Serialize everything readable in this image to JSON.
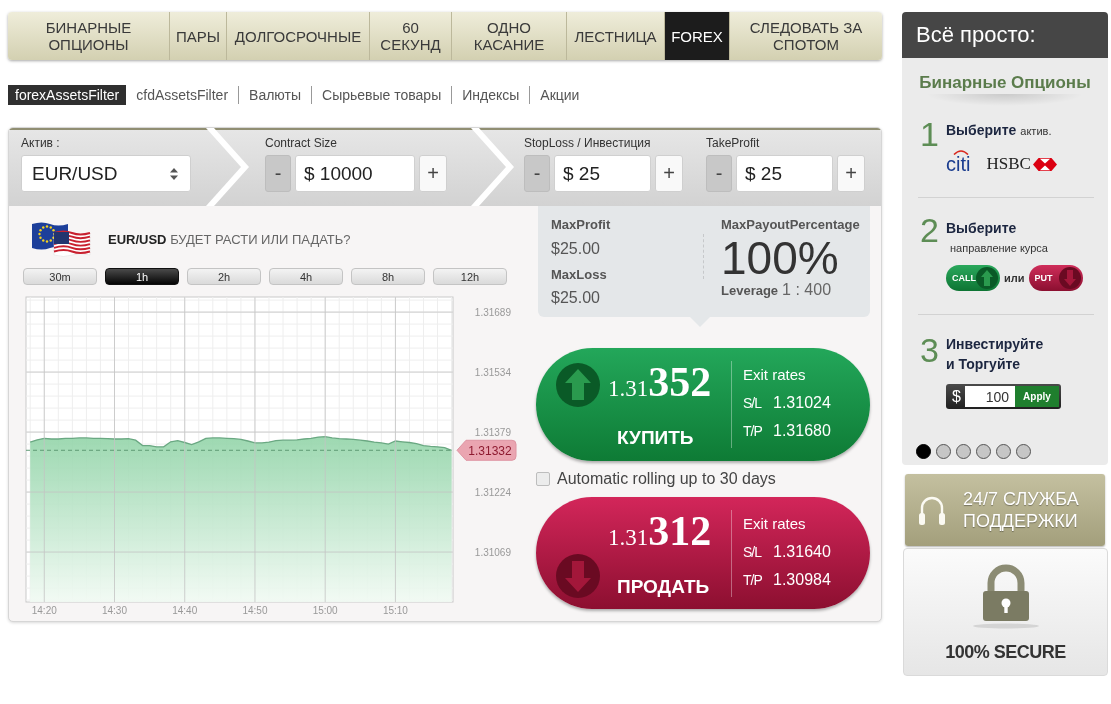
{
  "nav_tabs": [
    {
      "label": "БИНАРНЫЕ ОПЦИОНЫ",
      "selected": false
    },
    {
      "label": "ПАРЫ",
      "selected": false
    },
    {
      "label": "ДОЛГОСРОЧНЫЕ",
      "selected": false
    },
    {
      "label": "60 СЕКУНД",
      "selected": false
    },
    {
      "label": "ОДНО КАСАНИЕ",
      "selected": false
    },
    {
      "label": "ЛЕСТНИЦА",
      "selected": false
    },
    {
      "label": "FOREX",
      "selected": true
    },
    {
      "label": "СЛЕДОВАТЬ ЗА СПОТОМ",
      "selected": false
    }
  ],
  "asset_filters": [
    {
      "label": "forexAssetsFilter",
      "selected": true
    },
    {
      "label": "cfdAssetsFilter",
      "selected": false
    },
    {
      "label": "Валюты",
      "selected": false
    },
    {
      "label": "Сырьевые товары",
      "selected": false
    },
    {
      "label": "Индексы",
      "selected": false
    },
    {
      "label": "Акции",
      "selected": false
    }
  ],
  "order_bar": {
    "asset": {
      "label": "Актив :",
      "value": "EUR/USD"
    },
    "contract_size": {
      "label": "Contract Size",
      "decrement": "-",
      "value": "$ 10000",
      "increment": "+"
    },
    "stop_loss": {
      "label": "StopLoss / Инвестиция",
      "decrement": "-",
      "value": "$ 25",
      "increment": "+"
    },
    "take_profit": {
      "label": "TakeProfit",
      "decrement": "-",
      "value": "$ 25",
      "increment": "+"
    }
  },
  "chart_panel": {
    "title": "**EUR/USD** БУДЕТ РАСТИ ИЛИ ПАДАТЬ?",
    "timeframes": [
      {
        "label": "30m",
        "selected": false
      },
      {
        "label": "1h",
        "selected": true
      },
      {
        "label": "2h",
        "selected": false
      },
      {
        "label": "4h",
        "selected": false
      },
      {
        "label": "8h",
        "selected": false
      },
      {
        "label": "12h",
        "selected": false
      }
    ],
    "chart_data": {
      "type": "area",
      "categories": [
        null,
        null,
        "14:20",
        null,
        null,
        null,
        null,
        null,
        null,
        null,
        null,
        null,
        "14:30",
        null,
        null,
        null,
        null,
        null,
        null,
        null,
        null,
        null,
        "14:40",
        null,
        null,
        null,
        null,
        null,
        null,
        null,
        null,
        null,
        "14:50",
        null,
        null,
        null,
        null,
        null,
        null,
        null,
        null,
        null,
        "15:00",
        null,
        null,
        null,
        null,
        null,
        null,
        null,
        null,
        null,
        "15:10",
        null,
        null,
        null,
        null,
        null,
        null,
        null,
        null
      ],
      "values": [
        1.31353,
        1.31359,
        1.31363,
        1.31361,
        1.31361,
        1.31363,
        1.31363,
        1.31364,
        1.31364,
        1.31363,
        1.31363,
        1.31362,
        1.31361,
        1.31361,
        1.31362,
        1.31358,
        1.31344,
        1.31344,
        1.31341,
        1.31341,
        1.31354,
        1.31357,
        1.31352,
        1.31347,
        1.31354,
        1.31363,
        1.31364,
        1.31364,
        1.31363,
        1.31362,
        1.3136,
        1.31356,
        1.31351,
        1.31351,
        1.31353,
        1.31357,
        1.31358,
        1.31358,
        1.31359,
        1.31361,
        1.31363,
        1.31366,
        1.31367,
        1.31364,
        1.31362,
        1.31361,
        1.3136,
        1.31358,
        1.31356,
        1.31353,
        1.31351,
        1.31348,
        1.31356,
        1.31354,
        1.31352,
        1.31349,
        1.31344,
        1.31342,
        1.31341,
        1.31339,
        1.31332
      ],
      "ylim": [
        1.3094,
        1.31728
      ],
      "yticks": [
        1.31689,
        1.31534,
        1.31379,
        1.31224,
        1.31069
      ],
      "grid": true,
      "ref_lines": [
        {
          "axis": "y",
          "value": 1.31332,
          "label": "1.31332"
        }
      ]
    }
  },
  "summary": {
    "max_profit": {
      "label": "MaxProfit",
      "value": "$25.00"
    },
    "max_loss": {
      "label": "MaxLoss",
      "value": "$25.00"
    },
    "max_payout": {
      "label": "MaxPayoutPercentage",
      "value": "100%"
    },
    "leverage": {
      "label": "Leverage",
      "value": "1 : 400"
    }
  },
  "buy_button": {
    "kind": "buy",
    "price": "1.31**352**",
    "action": "КУПИТЬ",
    "exit_title": "Exit rates",
    "exit_rates": [
      {
        "label": "S/L",
        "value": "1.31024"
      },
      {
        "label": "T/P",
        "value": "1.31680"
      }
    ]
  },
  "auto_rolling": {
    "label": "Automatic rolling up to 30 days",
    "checked": false
  },
  "sell_button": {
    "kind": "sell",
    "price": "1.31**312**",
    "action": "ПРОДАТЬ",
    "exit_title": "Exit rates",
    "exit_rates": [
      {
        "label": "S/L",
        "value": "1.31640"
      },
      {
        "label": "T/P",
        "value": "1.30984"
      }
    ]
  },
  "sidebar": {
    "header": "Всё просто:",
    "subtitle": "Бинарные Опционы",
    "steps": [
      {
        "number": "1",
        "kind": "logos",
        "title": "Выберите",
        "note": "актив.",
        "logos": [
          "citi",
          "HSBC"
        ]
      },
      {
        "number": "2",
        "kind": "direction",
        "title": "Выберите",
        "note": "направление курса",
        "call": "CALL",
        "separator": "или",
        "put": "PUT"
      },
      {
        "number": "3",
        "kind": "amount",
        "title": "Инвестируйте и Торгуйте",
        "currency": "$",
        "amount": "100",
        "button": "Apply"
      }
    ],
    "slides": [
      {
        "selected": true
      },
      {
        "selected": false
      },
      {
        "selected": false
      },
      {
        "selected": false
      },
      {
        "selected": false
      },
      {
        "selected": false
      }
    ]
  },
  "support_button": {
    "label": "24/7 СЛУЖБА ПОДДЕРЖКИ"
  },
  "secure_badge": {
    "label": "100% SECURE"
  }
}
